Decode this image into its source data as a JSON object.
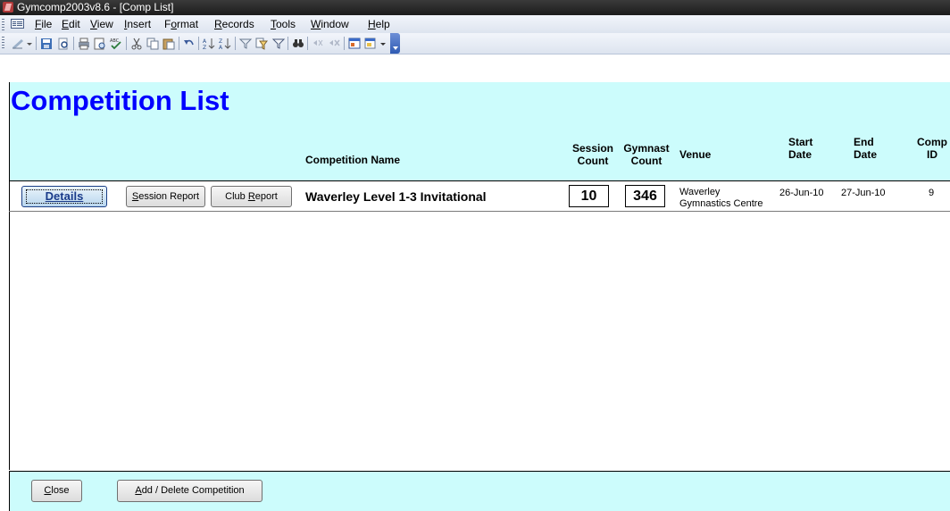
{
  "window": {
    "title": "Gymcomp2003v8.6 - [Comp List]"
  },
  "menu": {
    "items": [
      {
        "label": "File",
        "accel": "F"
      },
      {
        "label": "Edit",
        "accel": "E"
      },
      {
        "label": "View",
        "accel": "V"
      },
      {
        "label": "Insert",
        "accel": "I"
      },
      {
        "label": "Format",
        "accel": "o"
      },
      {
        "label": "Records",
        "accel": "R"
      },
      {
        "label": "Tools",
        "accel": "T"
      },
      {
        "label": "Window",
        "accel": "W"
      },
      {
        "label": "Help",
        "accel": "H"
      }
    ]
  },
  "toolbar": {
    "icons": [
      "design-view-icon",
      "save-icon",
      "search-icon",
      "print-icon",
      "print-preview-icon",
      "spelling-icon",
      "cut-icon",
      "copy-icon",
      "paste-icon",
      "undo-icon",
      "sort-ascending-icon",
      "sort-descending-icon",
      "filter-by-selection-icon",
      "filter-by-form-icon",
      "apply-filter-icon",
      "find-icon",
      "new-record-icon",
      "delete-record-icon",
      "database-window-icon",
      "new-object-icon"
    ]
  },
  "form": {
    "title": "Competition List",
    "columns": {
      "competition_name": "Competition Name",
      "session_count_1": "Session",
      "session_count_2": "Count",
      "gymnast_count_1": "Gymnast",
      "gymnast_count_2": "Count",
      "venue": "Venue",
      "start_date_1": "Start",
      "start_date_2": "Date",
      "end_date_1": "End",
      "end_date_2": "Date",
      "comp_id_1": "Comp",
      "comp_id_2": "ID"
    },
    "record": {
      "details_button": "Details",
      "session_report_button": {
        "pre": "",
        "accel": "S",
        "post": "ession Report"
      },
      "club_report_button": {
        "pre": "Club ",
        "accel": "R",
        "post": "eport"
      },
      "competition_name": "Waverley Level 1-3 Invitational",
      "session_count": "10",
      "gymnast_count": "346",
      "venue_line1": "Waverley",
      "venue_line2": "Gymnastics Centre",
      "start_date": "26-Jun-10",
      "end_date": "27-Jun-10",
      "comp_id": "9"
    },
    "footer": {
      "close_button": {
        "pre": "",
        "accel": "C",
        "post": "lose"
      },
      "add_delete_button": {
        "pre": "",
        "accel": "A",
        "post": "dd / Delete Competition"
      }
    }
  }
}
